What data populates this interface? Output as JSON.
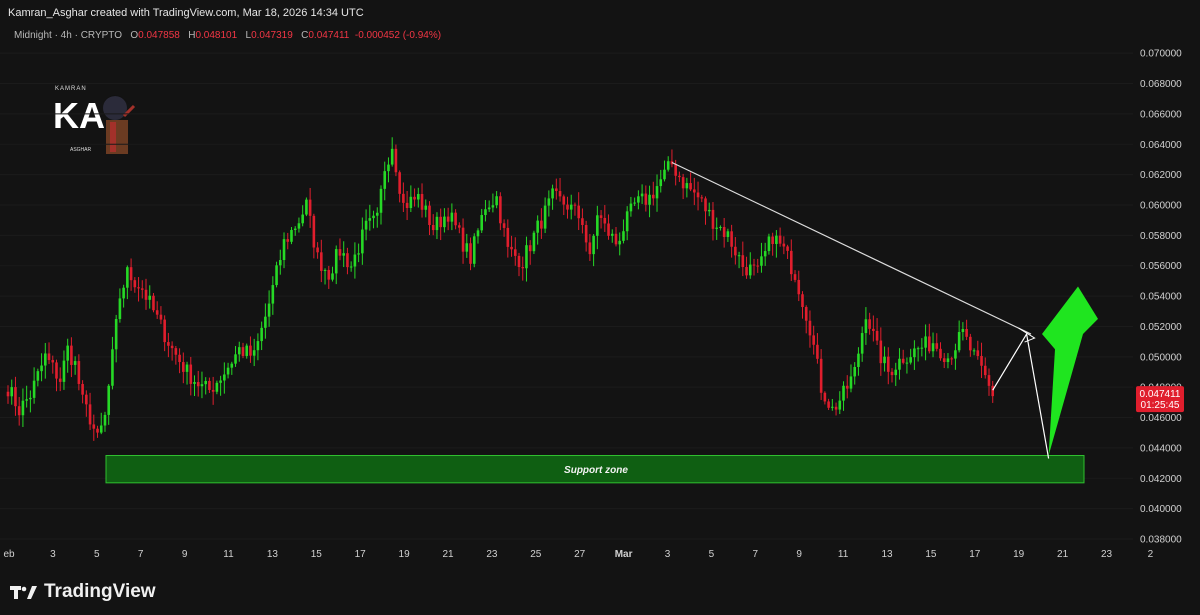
{
  "header": {
    "attribution": "Kamran_Asghar created with TradingView.com, Mar 18, 2026 14:34 UTC"
  },
  "legend": {
    "symbol": "Midnight · 4h · CRYPTO",
    "o_key": "O",
    "o_val": "0.047858",
    "h_key": "H",
    "h_val": "0.048101",
    "l_key": "L",
    "l_val": "0.047319",
    "c_key": "C",
    "c_val": "0.047411",
    "change": "-0.000452 (-0.94%)"
  },
  "logo": {
    "top_text": "KAMRAN",
    "letters": "KA",
    "bottom_text": "ASGHAR"
  },
  "brand": {
    "name": "TradingView"
  },
  "colors": {
    "background": "#131313",
    "up": "#26d926",
    "down": "#e01e2d",
    "support_fill": "#0f5f12",
    "support_border": "#2fbf2f",
    "arrow": "#1fe51f",
    "trendline": "#dddddd",
    "price_badge": "#e01e2d"
  },
  "chart_data": {
    "type": "candlestick",
    "timeframe": "4h",
    "ylim": [
      0.038,
      0.071
    ],
    "y_ticks": [
      "0.038000",
      "0.040000",
      "0.042000",
      "0.044000",
      "0.046000",
      "0.048000",
      "0.050000",
      "0.052000",
      "0.054000",
      "0.056000",
      "0.058000",
      "0.060000",
      "0.062000",
      "0.064000",
      "0.066000",
      "0.068000",
      "0.070000"
    ],
    "x_ticks": [
      "eb",
      "3",
      "5",
      "7",
      "9",
      "11",
      "13",
      "15",
      "17",
      "19",
      "21",
      "23",
      "25",
      "27",
      "Mar",
      "3",
      "5",
      "7",
      "9",
      "11",
      "13",
      "15",
      "17",
      "19",
      "21",
      "23",
      "2"
    ],
    "last_price": "0.047411",
    "countdown": "01:25:45",
    "anchors": [
      [
        0,
        0.048
      ],
      [
        3,
        0.0465
      ],
      [
        6,
        0.0475
      ],
      [
        10,
        0.05
      ],
      [
        14,
        0.0485
      ],
      [
        16,
        0.0505
      ],
      [
        18,
        0.0495
      ],
      [
        20,
        0.047
      ],
      [
        22,
        0.046
      ],
      [
        24,
        0.0445
      ],
      [
        26,
        0.046
      ],
      [
        28,
        0.05
      ],
      [
        30,
        0.054
      ],
      [
        32,
        0.0555
      ],
      [
        36,
        0.0545
      ],
      [
        40,
        0.0525
      ],
      [
        44,
        0.0505
      ],
      [
        48,
        0.049
      ],
      [
        52,
        0.048
      ],
      [
        54,
        0.0478
      ],
      [
        58,
        0.049
      ],
      [
        62,
        0.0505
      ],
      [
        66,
        0.05
      ],
      [
        70,
        0.0535
      ],
      [
        74,
        0.0575
      ],
      [
        78,
        0.059
      ],
      [
        80,
        0.06
      ],
      [
        83,
        0.0565
      ],
      [
        86,
        0.0555
      ],
      [
        89,
        0.057
      ],
      [
        92,
        0.056
      ],
      [
        96,
        0.0585
      ],
      [
        99,
        0.059
      ],
      [
        101,
        0.0625
      ],
      [
        103,
        0.064
      ],
      [
        106,
        0.06
      ],
      [
        110,
        0.0605
      ],
      [
        114,
        0.0585
      ],
      [
        118,
        0.0595
      ],
      [
        121,
        0.058
      ],
      [
        124,
        0.0565
      ],
      [
        128,
        0.06
      ],
      [
        131,
        0.0605
      ],
      [
        134,
        0.057
      ],
      [
        138,
        0.0563
      ],
      [
        142,
        0.0585
      ],
      [
        146,
        0.0605
      ],
      [
        150,
        0.06
      ],
      [
        154,
        0.059
      ],
      [
        156,
        0.0563
      ],
      [
        158,
        0.0595
      ],
      [
        160,
        0.0585
      ],
      [
        163,
        0.0575
      ],
      [
        166,
        0.059
      ],
      [
        168,
        0.06
      ],
      [
        172,
        0.0605
      ],
      [
        176,
        0.062
      ],
      [
        178,
        0.0627
      ],
      [
        181,
        0.0615
      ],
      [
        185,
        0.0605
      ],
      [
        189,
        0.059
      ],
      [
        193,
        0.058
      ],
      [
        197,
        0.056
      ],
      [
        201,
        0.0555
      ],
      [
        205,
        0.058
      ],
      [
        208,
        0.057
      ],
      [
        211,
        0.0555
      ],
      [
        215,
        0.052
      ],
      [
        218,
        0.048
      ],
      [
        221,
        0.0465
      ],
      [
        224,
        0.0475
      ],
      [
        227,
        0.049
      ],
      [
        230,
        0.053
      ],
      [
        233,
        0.0505
      ],
      [
        236,
        0.049
      ],
      [
        240,
        0.05
      ],
      [
        244,
        0.0505
      ],
      [
        248,
        0.051
      ],
      [
        252,
        0.05
      ],
      [
        256,
        0.0515
      ],
      [
        260,
        0.0495
      ],
      [
        262,
        0.0486
      ],
      [
        264,
        0.0474
      ]
    ],
    "support_zone": {
      "label": "Support zone",
      "from": 0.0417,
      "to": 0.0435
    },
    "annotations": [
      {
        "type": "trendline",
        "from_bar": 178,
        "from_price": 0.0628,
        "to_date": "Mar 20",
        "to_price": 0.0515
      },
      {
        "type": "path",
        "points": [
          [
            "Mar 18.5",
            0.0478
          ],
          [
            "Mar 19.8",
            0.0515
          ],
          [
            "Mar 20.8",
            0.0433
          ]
        ]
      },
      {
        "type": "arrow",
        "direction": "up",
        "from_price": 0.0435,
        "to_price": 0.0545
      }
    ]
  }
}
